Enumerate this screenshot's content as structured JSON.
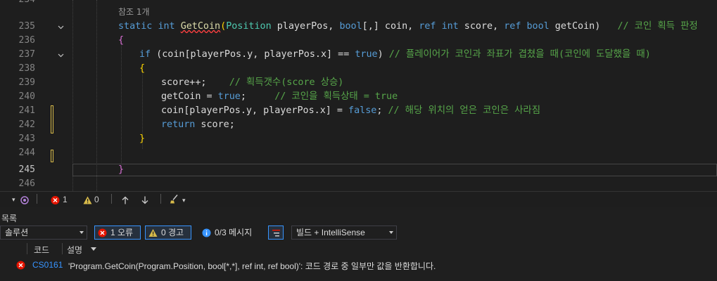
{
  "editor": {
    "codelens": "참조 1개",
    "lines": [
      {
        "num": "234"
      },
      {
        "num": "235"
      },
      {
        "num": "236"
      },
      {
        "num": "237"
      },
      {
        "num": "238"
      },
      {
        "num": "239"
      },
      {
        "num": "240"
      },
      {
        "num": "241"
      },
      {
        "num": "242"
      },
      {
        "num": "243"
      },
      {
        "num": "244"
      },
      {
        "num": "245"
      },
      {
        "num": "246"
      }
    ],
    "l235": {
      "static": "static",
      "int": "int",
      "name": "GetCoin",
      "p1": "(",
      "t1": "Position",
      "a1": " playerPos, ",
      "t2": "bool",
      "a2": "[,] coin, ",
      "r1": "ref",
      "t3": "int",
      "a3": " score, ",
      "r2": "ref",
      "t4": "bool",
      "a4": " getCoin)",
      "comment": "// 코인 획득 판정"
    },
    "l236": {
      "brace": "{"
    },
    "l237": {
      "if": "if",
      "a": " (coin[playerPos.y, playerPos.x] == ",
      "tr": "true",
      "b": ") ",
      "comment": "// 플레이어가 코인과 좌표가 겹쳤을 때(코인에 도달했을 때)"
    },
    "l238": {
      "brace": "{"
    },
    "l239": {
      "a": "score++;",
      "comment": "// 획득갯수(score 상승)"
    },
    "l240": {
      "a": "getCoin = ",
      "tr": "true",
      "b": ";",
      "comment": "// 코인을 획득상태 = true"
    },
    "l241": {
      "a": "coin[playerPos.y, playerPos.x] = ",
      "fl": "false",
      "b": "; ",
      "comment": "// 해당 위치의 얻은 코인은 사라짐"
    },
    "l242": {
      "ret": "return",
      "a": " score;"
    },
    "l243": {
      "brace": "}"
    },
    "l245": {
      "brace": "}"
    }
  },
  "editor_status": {
    "zoom_arrow": "▾",
    "errors": "1",
    "warnings": "0"
  },
  "error_panel": {
    "title": "목록",
    "scope": "솔루션",
    "errors_label": "1 오류",
    "warnings_label": "0 경고",
    "messages_label": "0/3 메시지",
    "build_option": "빌드 + IntelliSense",
    "columns": [
      "코드",
      "설명"
    ],
    "rows": [
      {
        "code": "CS0161",
        "description": "'Program.GetCoin(Program.Position, bool[*,*], ref int, ref bool)': 코드 경로 중 일부만 값을 반환합니다."
      }
    ]
  },
  "colors": {
    "keyword": "#569cd6",
    "type": "#4ec9b0",
    "function": "#dcdcaa",
    "comment": "#57a64a",
    "error": "#e51400",
    "warning": "#d7ba4a",
    "accent": "#3794ff"
  }
}
